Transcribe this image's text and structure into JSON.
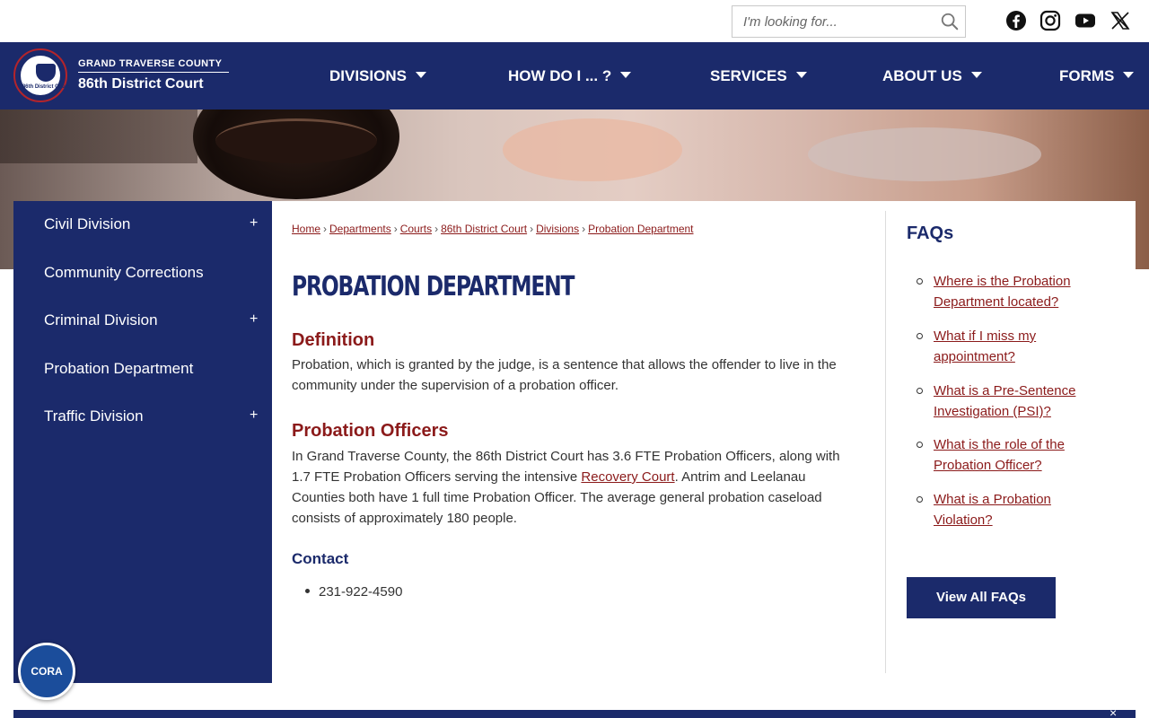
{
  "search": {
    "placeholder": "I'm looking for..."
  },
  "social": [
    "facebook-icon",
    "instagram-icon",
    "youtube-icon",
    "x-icon"
  ],
  "brand": {
    "county": "GRAND TRAVERSE COUNTY",
    "court": "86th District Court",
    "seal_text": "86th District Court"
  },
  "nav": [
    {
      "label": "DIVISIONS"
    },
    {
      "label": "HOW DO I ... ?"
    },
    {
      "label": "SERVICES"
    },
    {
      "label": "ABOUT US"
    },
    {
      "label": "FORMS"
    }
  ],
  "sidebar": {
    "items": [
      {
        "label": "Civil Division",
        "expand": "+"
      },
      {
        "label": "Community Corrections"
      },
      {
        "label": "Criminal Division",
        "expand": "+"
      },
      {
        "label": "Probation Department"
      },
      {
        "label": "Traffic Division",
        "expand": "+"
      }
    ]
  },
  "breadcrumb": [
    "Home",
    "Departments",
    "Courts",
    "86th District Court",
    "Divisions",
    "Probation Department"
  ],
  "main": {
    "title": "PROBATION DEPARTMENT",
    "definition_heading": "Definition",
    "definition_text": "Probation, which is granted by the judge, is a sentence that allows the offender to live in the community under the supervision of a probation officer.",
    "officers_heading": "Probation Officers",
    "officers_text_before": "In Grand Traverse County, the 86th District Court has 3.6 FTE Probation Officers, along with 1.7 FTE Probation Officers serving the intensive ",
    "officers_link": "Recovery Court",
    "officers_text_after": ".  Antrim and Leelanau Counties both have 1 full time Probation Officer. The average general probation caseload consists of approximately 180 people.",
    "contact_heading": "Contact",
    "contact_phone": "231-922-4590"
  },
  "faqs": {
    "heading": "FAQs",
    "items": [
      "Where is the Probation Department located?",
      "What if I miss my appointment?",
      "What is a Pre-Sentence Investigation (PSI)?",
      "What is the role of the Probation Officer?",
      "What is a Probation Violation?"
    ],
    "button": "View All FAQs"
  },
  "cora": {
    "label": "CORA"
  },
  "footer": {
    "close": "×"
  },
  "colors": {
    "navy": "#1b2a6b",
    "maroon": "#8b1a1a",
    "seal_ring": "#b3242b",
    "cora_blue": "#1b4d9b"
  }
}
